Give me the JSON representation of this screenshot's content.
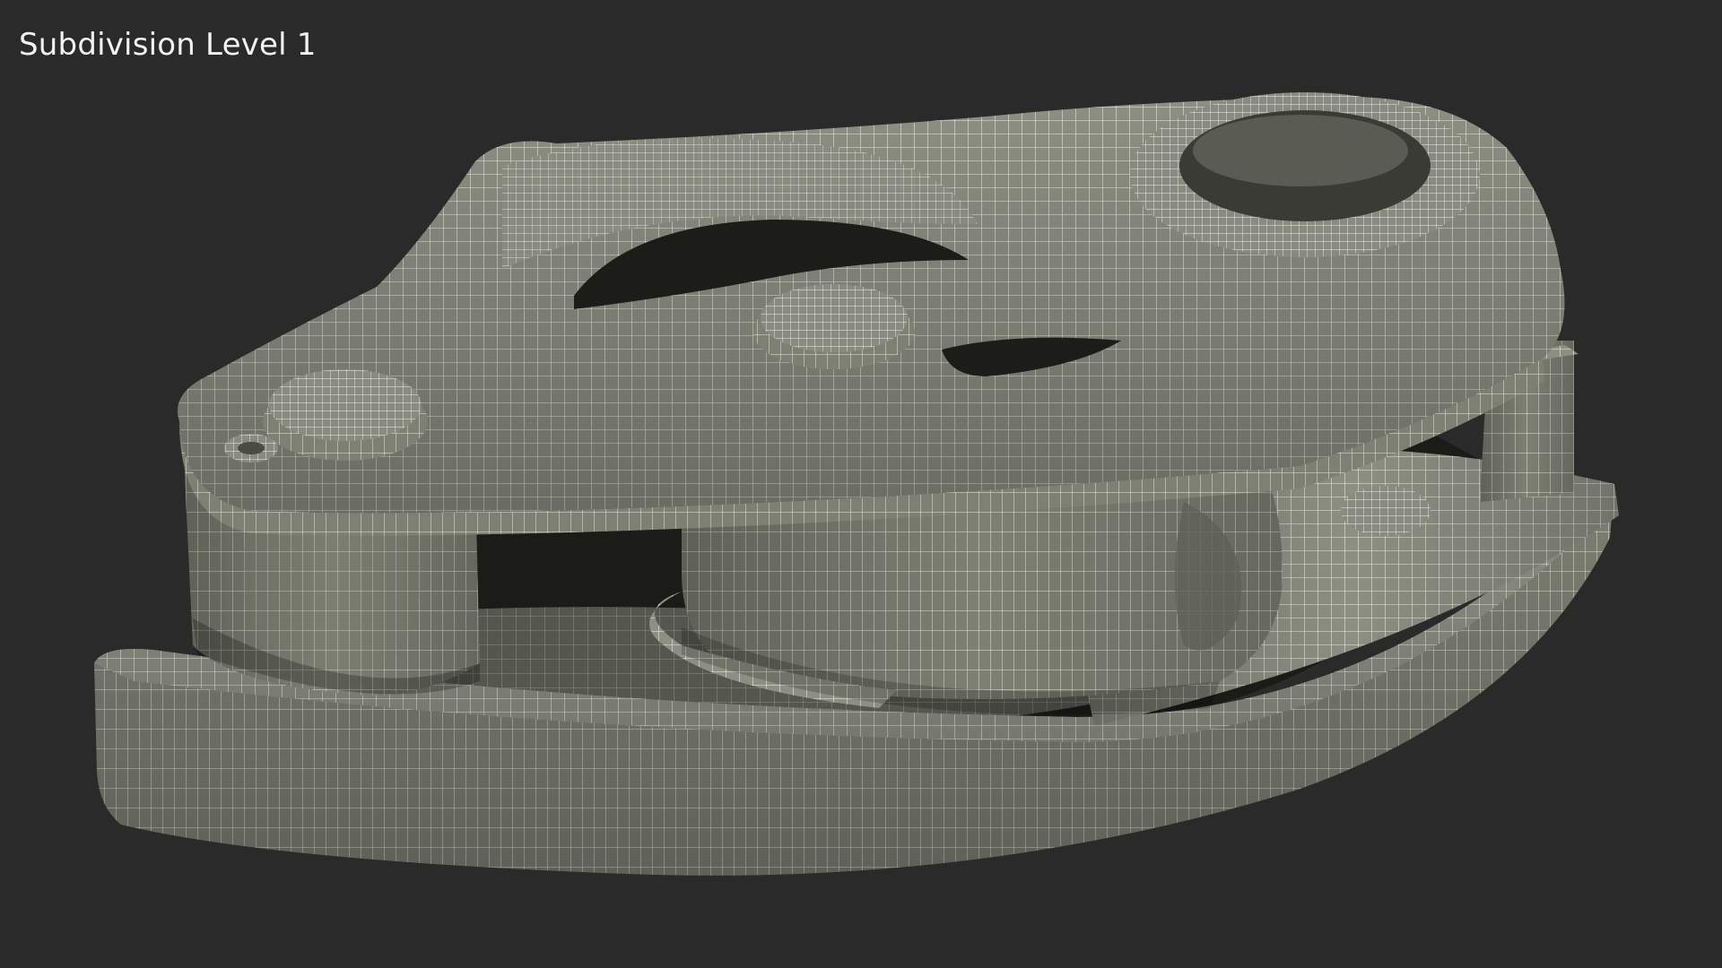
{
  "viewport": {
    "overlay_label": "Subdivision Level 1",
    "background_color": "#2a2a2a",
    "model_color": "#8e8f83",
    "wire_color": "#eef0e6",
    "shadow_color": "#1a1a17"
  }
}
